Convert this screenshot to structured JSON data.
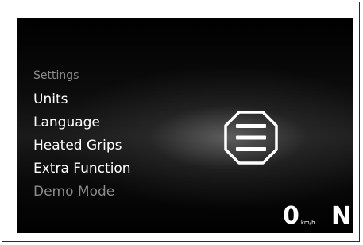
{
  "menu": {
    "header": "Settings",
    "items": [
      {
        "label": "Units",
        "state": "enabled"
      },
      {
        "label": "Language",
        "state": "enabled"
      },
      {
        "label": "Heated Grips",
        "state": "enabled"
      },
      {
        "label": "Extra Function",
        "state": "enabled"
      },
      {
        "label": "Demo Mode",
        "state": "disabled"
      }
    ]
  },
  "status": {
    "speed": "0",
    "speed_unit": "km/h",
    "gear": "N"
  },
  "icons": {
    "menu_icon": "menu-icon"
  },
  "colors": {
    "screen_bg": "#000000",
    "text_active": "#ffffff",
    "text_inactive": "#8a8a8a"
  }
}
